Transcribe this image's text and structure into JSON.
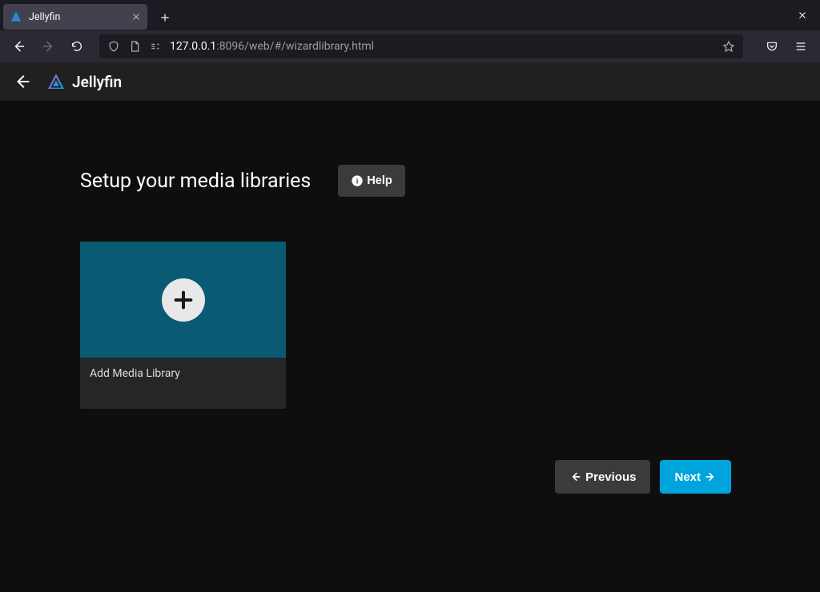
{
  "browser": {
    "tab_title": "Jellyfin",
    "url_host": "127.0.0.1",
    "url_port_path": ":8096/web/#/wizardlibrary.html"
  },
  "app": {
    "brand_name": "Jellyfin"
  },
  "page": {
    "title": "Setup your media libraries",
    "help_label": "Help",
    "add_library_label": "Add Media Library",
    "previous_label": "Previous",
    "next_label": "Next"
  },
  "colors": {
    "accent": "#00a4dc",
    "card_teal": "#0a5a74"
  }
}
